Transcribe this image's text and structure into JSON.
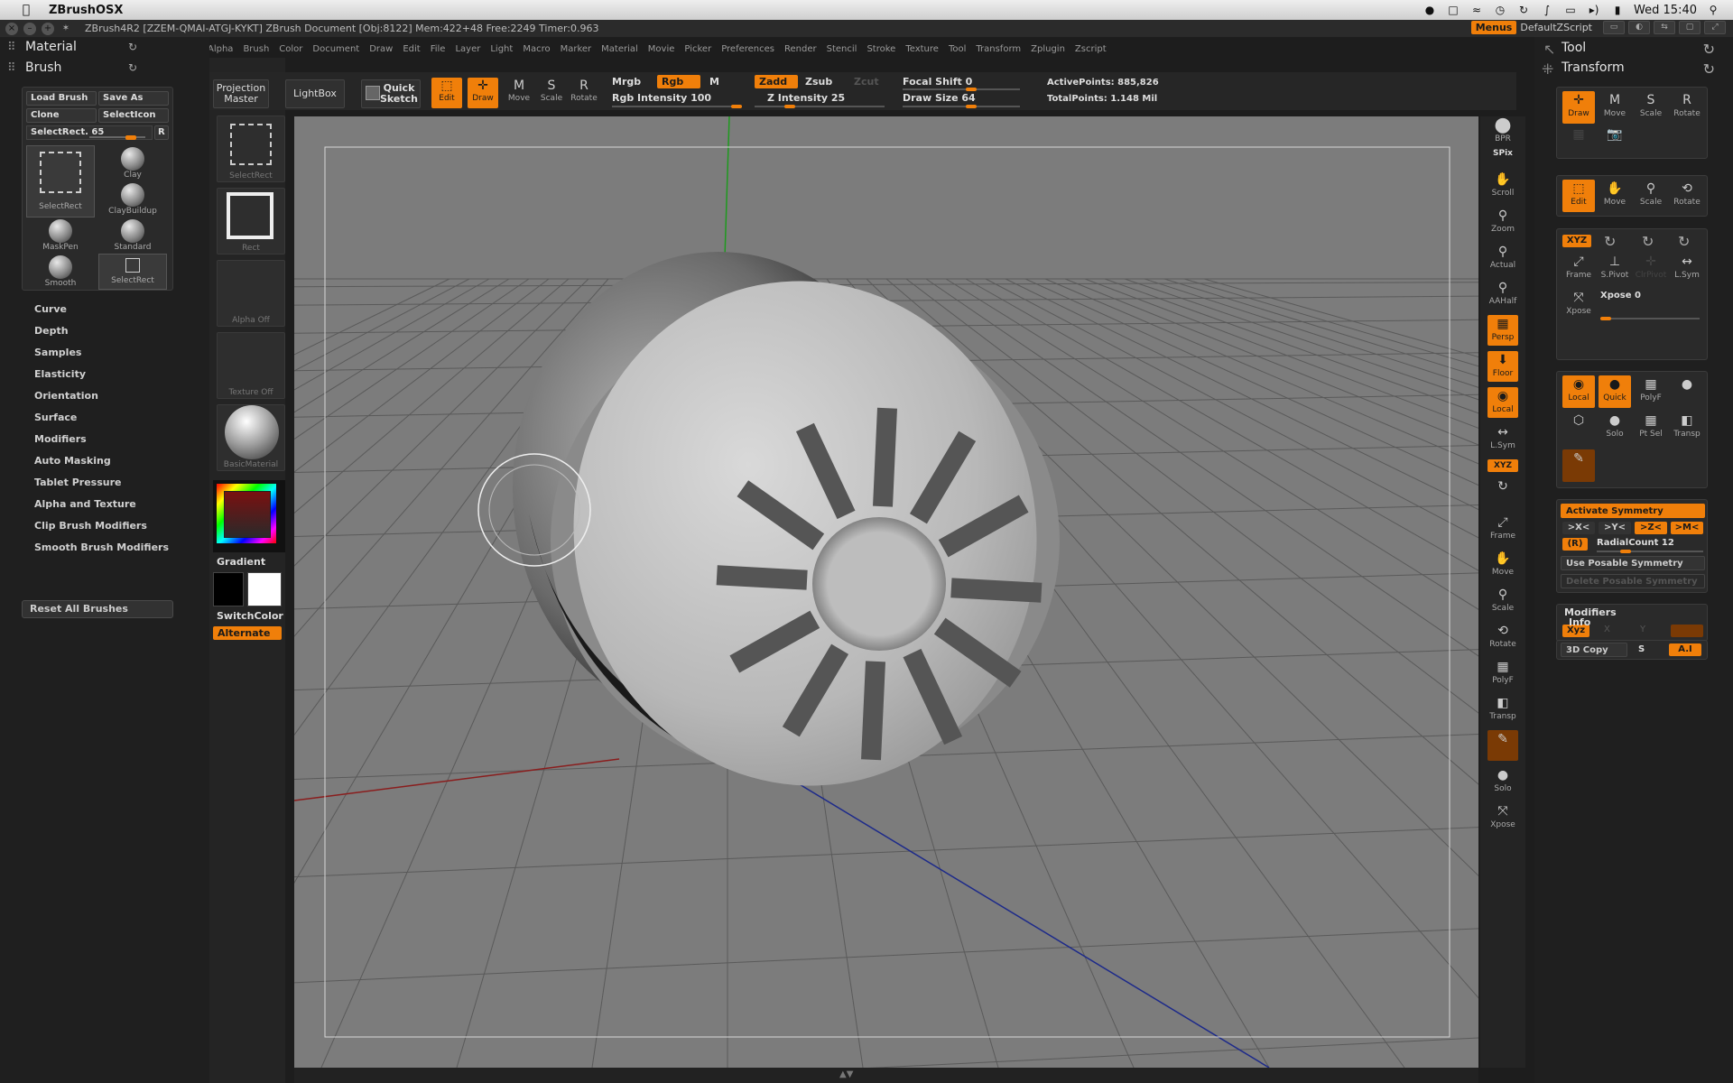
{
  "mac": {
    "app_name": "ZBrushOSX",
    "clock": "Wed 15:40"
  },
  "titlebar": {
    "info": "ZBrush4R2 [ZZEM-QMAI-ATGJ-KYKT]   ZBrush Document    [Obj:8122]  Mem:422+48  Free:2249  Timer:0.963",
    "menus_label": "Menus",
    "default_script": "DefaultZScript"
  },
  "menubar": [
    "Alpha",
    "Brush",
    "Color",
    "Document",
    "Draw",
    "Edit",
    "File",
    "Layer",
    "Light",
    "Macro",
    "Marker",
    "Material",
    "Movie",
    "Picker",
    "Preferences",
    "Render",
    "Stencil",
    "Stroke",
    "Texture",
    "Tool",
    "Transform",
    "Zplugin",
    "Zscript"
  ],
  "left": {
    "material_title": "Material",
    "brush_title": "Brush",
    "load_brush": "Load Brush",
    "save_as": "Save As",
    "clone": "Clone",
    "select_icon": "SelectIcon",
    "select_rect": "SelectRect. 65",
    "select_rect_level": 0.65,
    "r_label": "R",
    "brushes": [
      "SelectRect",
      "Clay",
      "ClayBuildup",
      "MaskPen",
      "Standard",
      "Smooth",
      "SelectRect"
    ],
    "menu": [
      "Curve",
      "Depth",
      "Samples",
      "Elasticity",
      "Orientation",
      "Surface",
      "Modifiers",
      "Auto Masking",
      "Tablet Pressure",
      "Alpha and Texture",
      "Clip Brush Modifiers",
      "Smooth Brush Modifiers"
    ],
    "reset": "Reset All Brushes"
  },
  "tray": {
    "select_rect": "SelectRect",
    "rect": "Rect",
    "alpha_off": "Alpha Off",
    "texture_off": "Texture Off",
    "material": "BasicMaterial",
    "gradient": "Gradient",
    "switch_color": "SwitchColor",
    "alternate": "Alternate"
  },
  "top": {
    "projection_master_1": "Projection",
    "projection_master_2": "Master",
    "lightbox": "LightBox",
    "quick_sketch_1": "Quick",
    "quick_sketch_2": "Sketch",
    "edit": "Edit",
    "draw": "Draw",
    "move": "Move",
    "scale": "Scale",
    "rotate": "Rotate",
    "mrgb": "Mrgb",
    "rgb": "Rgb",
    "m": "M",
    "rgb_intensity": "Rgb  Intensity 100",
    "rgb_intensity_value": 100,
    "zadd": "Zadd",
    "zsub": "Zsub",
    "zcut": "Zcut",
    "z_intensity": "Z  Intensity 25",
    "z_intensity_value": 25,
    "focal_shift": "Focal Shift 0",
    "draw_size": "Draw Size 64",
    "active_points": "ActivePoints: 885,826",
    "total_points": "TotalPoints: 1.148  Mil"
  },
  "right_tray": [
    "BPR",
    "SPix",
    "Scroll",
    "Zoom",
    "Actual",
    "AAHalf",
    "Persp",
    "Floor",
    "Local",
    "L.Sym",
    "XYZ",
    "Frame",
    "Move",
    "Scale",
    "Rotate",
    "PolyF",
    "Transp",
    "Solo",
    "Xpose"
  ],
  "right": {
    "tool_title": "Tool",
    "transform_title": "Transform",
    "row1": [
      "Draw",
      "Move",
      "Scale",
      "Rotate"
    ],
    "row2": [
      "Edit",
      "Move",
      "Scale",
      "Rotate"
    ],
    "xyz": "XYZ",
    "frame": "Frame",
    "spivot": "S.Pivot",
    "clrpivot": "ClrPivot",
    "lsym": "L.Sym",
    "xpose_btn": "Xpose",
    "xpose_val": "Xpose 0",
    "local": "Local",
    "quick": "Quick",
    "polyf": "PolyF",
    "solo": "Solo",
    "ptsel": "Pt Sel",
    "transp": "Transp",
    "activate_symmetry": "Activate Symmetry",
    "axis_x": ">X<",
    "axis_y": ">Y<",
    "axis_z": ">Z<",
    "axis_m": ">M<",
    "r_btn": "(R)",
    "radial_count": "RadialCount 12",
    "use_posable": "Use Posable Symmetry",
    "delete_posable": "Delete Posable Symmetry",
    "modifiers": "Modifiers",
    "mod_xyz": "Xyz",
    "mod_x": "X",
    "mod_y": "Y",
    "info": "Info",
    "copy_3d": "3D Copy",
    "s_label": "S",
    "a_label": "A.I"
  },
  "colors": {
    "accent": "#f07f0a",
    "panel": "#1f1f1f",
    "viewport": "#7c7c7c"
  }
}
